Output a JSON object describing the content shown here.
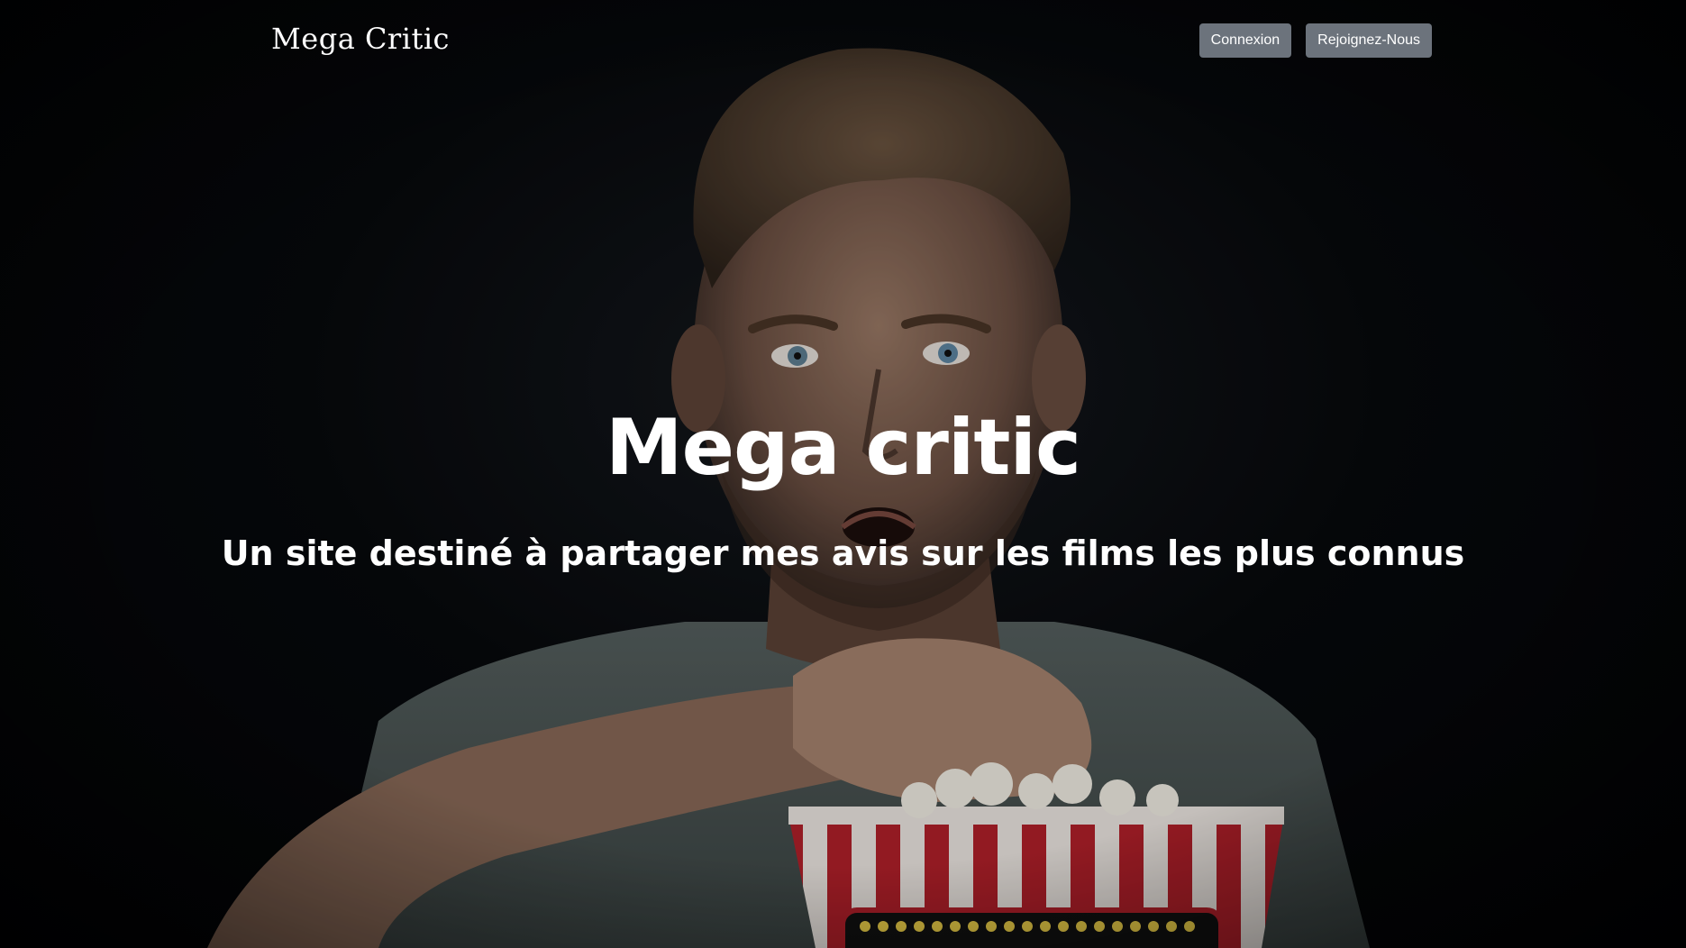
{
  "navbar": {
    "brand": "Mega Critic",
    "login_label": "Connexion",
    "signup_label": "Rejoignez-Nous"
  },
  "hero": {
    "title": "Mega critic",
    "subtitle": "Un site destiné à partager mes avis sur les films les plus connus"
  }
}
